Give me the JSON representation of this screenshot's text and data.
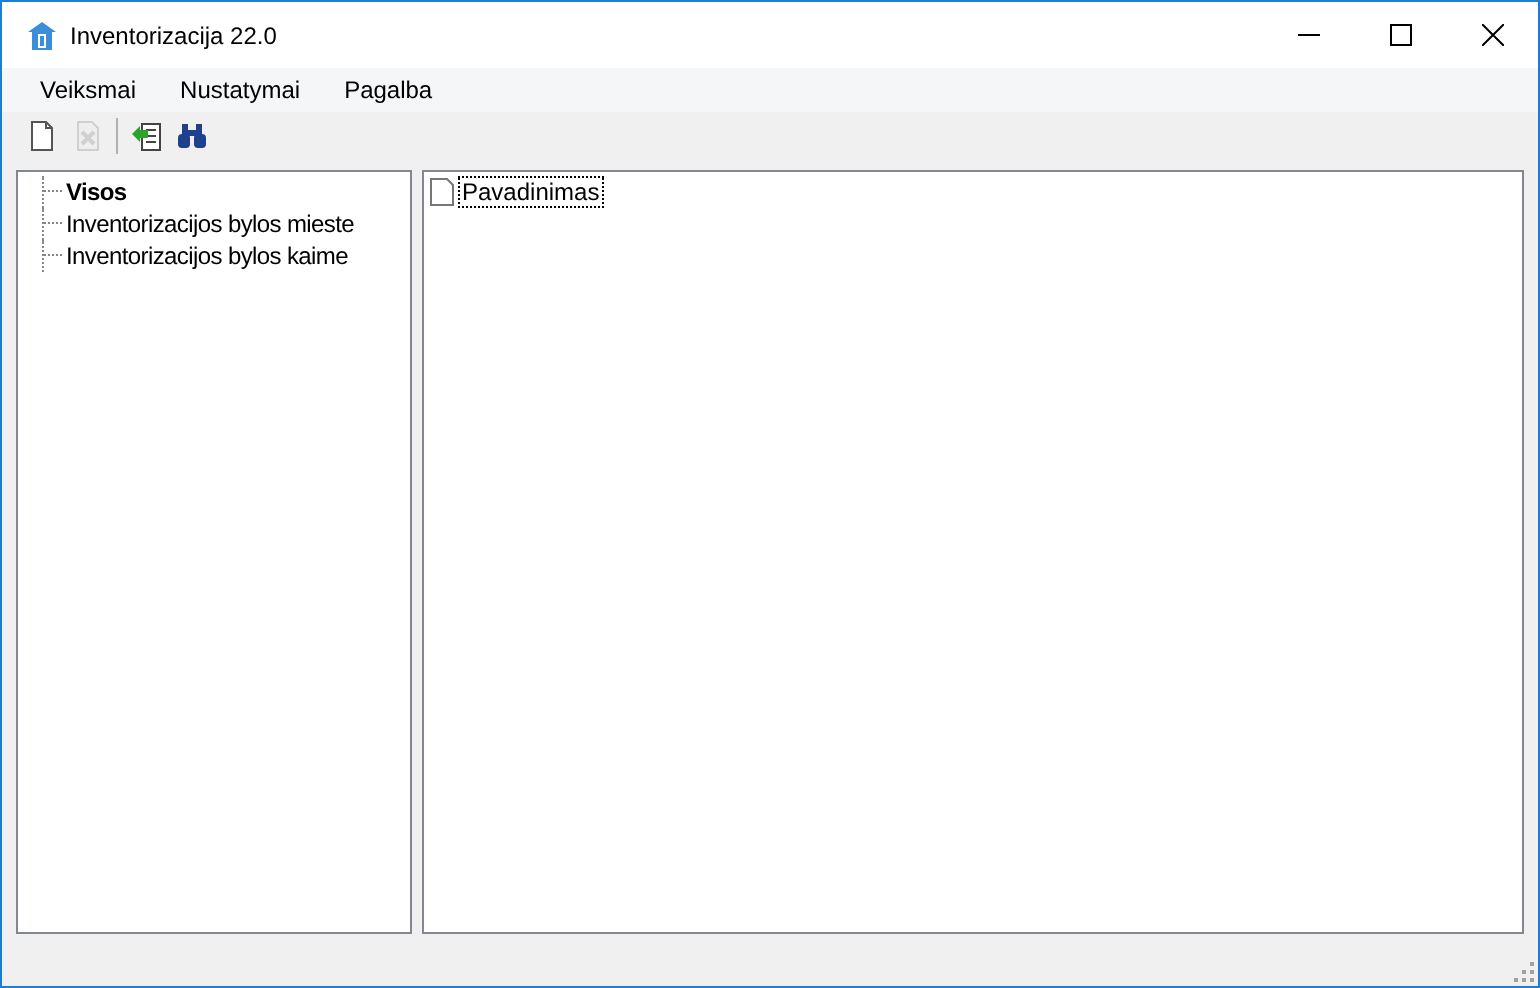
{
  "window": {
    "title": "Inventorizacija 22.0"
  },
  "menu": [
    "Veiksmai",
    "Nustatymai",
    "Pagalba"
  ],
  "toolbar": [
    {
      "kind": "new",
      "disabled": false
    },
    {
      "kind": "delete",
      "disabled": true
    },
    {
      "kind": "separator"
    },
    {
      "kind": "import",
      "disabled": false
    },
    {
      "kind": "find",
      "disabled": false
    }
  ],
  "tree": [
    {
      "label": "Visos",
      "selected": true
    },
    {
      "label": "Inventorizacijos bylos mieste",
      "selected": false
    },
    {
      "label": "Inventorizacijos bylos kaime",
      "selected": false
    }
  ],
  "list": [
    {
      "label": "Pavadinimas",
      "focused": true
    }
  ]
}
